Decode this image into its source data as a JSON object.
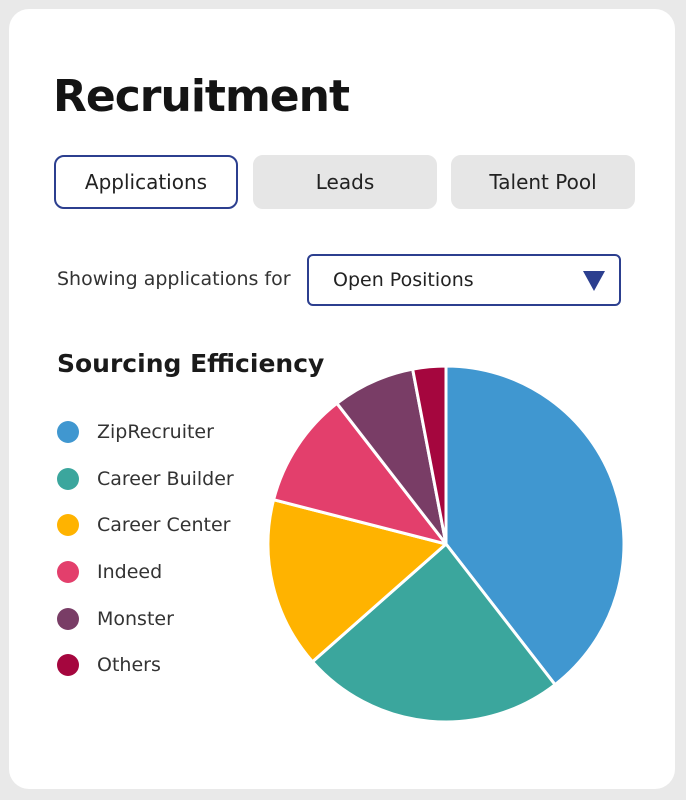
{
  "header": {
    "title": "Recruitment"
  },
  "tabs": [
    {
      "label": "Applications",
      "active": true
    },
    {
      "label": "Leads",
      "active": false
    },
    {
      "label": "Talent Pool",
      "active": false
    }
  ],
  "filter": {
    "label": "Showing applications for",
    "selected": "Open Positions",
    "icon": "triangle-down-icon"
  },
  "chart_title": "Sourcing Efficiency",
  "colors": {
    "accent": "#2c3f8f"
  },
  "chart_data": {
    "type": "pie",
    "title": "Sourcing Efficiency",
    "legend_position": "left",
    "categories": [
      "ZipRecruiter",
      "Career Builder",
      "Career Center",
      "Indeed",
      "Monster",
      "Others"
    ],
    "values": [
      39.5,
      24,
      15.5,
      10.5,
      7.5,
      3
    ],
    "colors": [
      "#4097d0",
      "#3ba69d",
      "#ffb300",
      "#e33f6c",
      "#793d66",
      "#a5063e"
    ]
  }
}
